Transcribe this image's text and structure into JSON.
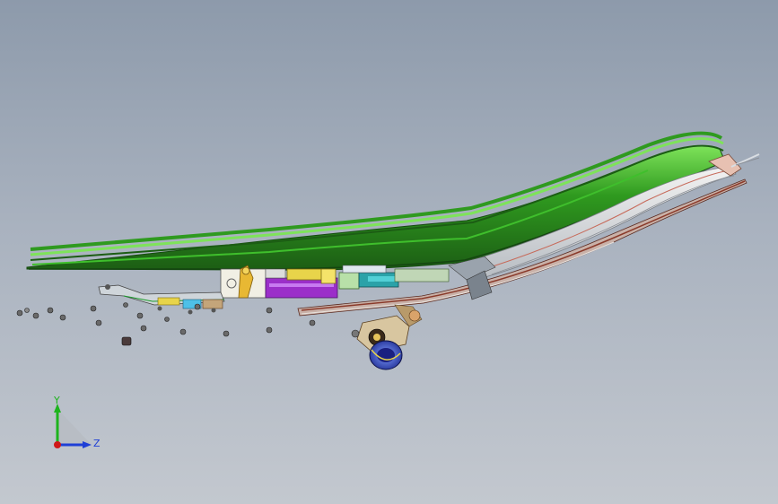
{
  "viewport": {
    "background_top": "#8d9aab",
    "background_bottom": "#c3c8cf"
  },
  "model": {
    "name": "",
    "colors": {
      "sheet_green": "#2f9a1f",
      "sheet_green_light": "#6ad34a",
      "sheet_green_dark": "#1c5d14",
      "bracket_yellow": "#e8d44a",
      "bracket_purple": "#9b2fc9",
      "rail_red": "#8a3a2a",
      "rail_grey": "#d9dde2",
      "cap_blue": "#2233aa",
      "hardware_grey": "#6a6a6a"
    },
    "fasteners_count_shown": 18
  },
  "triad": {
    "y_label": "Y",
    "z_label": "Z",
    "y_color": "#1db41d",
    "z_color": "#1f3fd6",
    "x_color": "#d01818"
  }
}
